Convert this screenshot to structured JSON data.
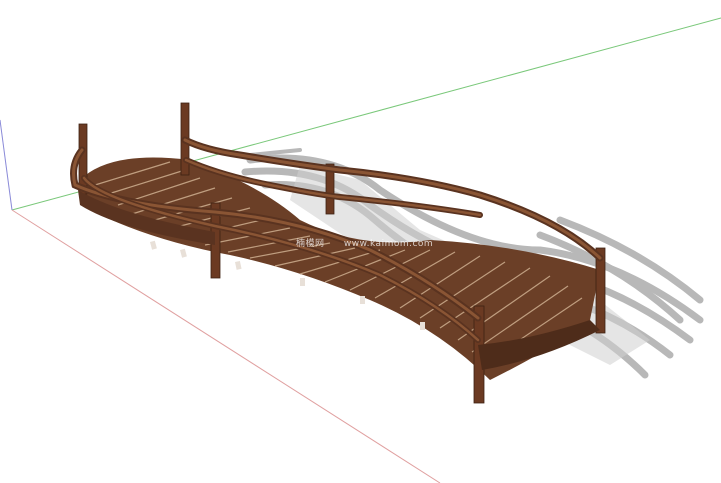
{
  "scene": {
    "subject": "curved wooden footbridge 3D model",
    "watermark": {
      "site_cn": "楠模网",
      "site_url": "www.kaimom.com"
    },
    "colors": {
      "background": "#ffffff",
      "wood_dark": "#5a3320",
      "wood_mid": "#7a4a2e",
      "wood_light": "#9a6440",
      "shadow": "#b8b8b8",
      "axis_red": "#e0a0a0",
      "axis_green": "#7ac87a",
      "axis_blue": "#8a8ad8"
    }
  }
}
